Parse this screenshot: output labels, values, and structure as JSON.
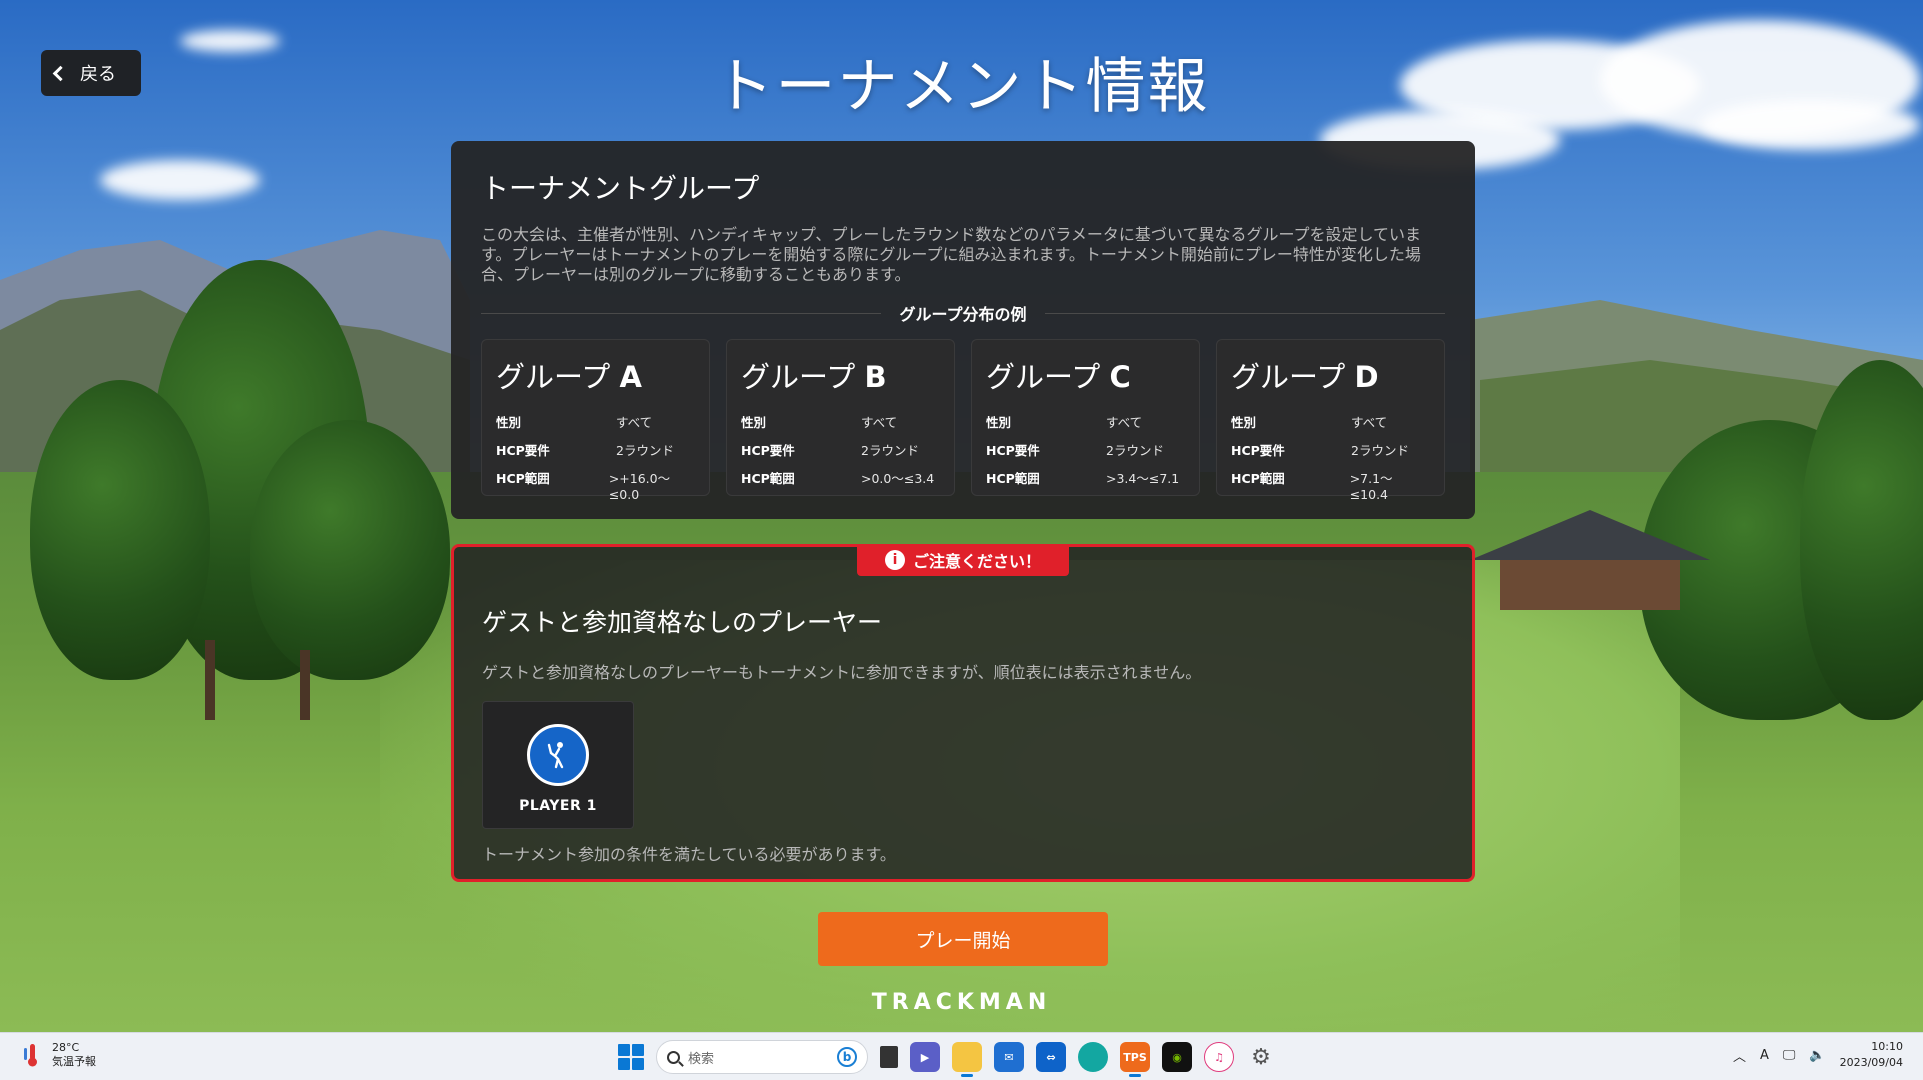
{
  "header": {
    "back_label": "戻る",
    "title": "トーナメント情報"
  },
  "groups_panel": {
    "title": "トーナメントグループ",
    "description": "この大会は、主催者が性別、ハンディキャップ、プレーしたラウンド数などのパラメータに基づいて異なるグループを設定しています。プレーヤーはトーナメントのプレーを開始する際にグループに組み込まれます。トーナメント開始前にプレー特性が変化した場合、プレーヤーは別のグループに移動することもあります。",
    "example_label": "グループ分布の例",
    "groups": [
      {
        "prefix": "グループ ",
        "letter": "A",
        "rows": [
          {
            "k": "性別",
            "v": "すべて"
          },
          {
            "k": "HCP要件",
            "v": "2ラウンド"
          },
          {
            "k": "HCP範囲",
            "v": ">+16.0〜≤0.0"
          }
        ]
      },
      {
        "prefix": "グループ ",
        "letter": "B",
        "rows": [
          {
            "k": "性別",
            "v": "すべて"
          },
          {
            "k": "HCP要件",
            "v": "2ラウンド"
          },
          {
            "k": "HCP範囲",
            "v": ">0.0〜≤3.4"
          }
        ]
      },
      {
        "prefix": "グループ ",
        "letter": "C",
        "rows": [
          {
            "k": "性別",
            "v": "すべて"
          },
          {
            "k": "HCP要件",
            "v": "2ラウンド"
          },
          {
            "k": "HCP範囲",
            "v": ">3.4〜≤7.1"
          }
        ]
      },
      {
        "prefix": "グループ ",
        "letter": "D",
        "rows": [
          {
            "k": "性別",
            "v": "すべて"
          },
          {
            "k": "HCP要件",
            "v": "2ラウンド"
          },
          {
            "k": "HCP範囲",
            "v": ">7.1〜≤10.4"
          }
        ]
      }
    ]
  },
  "guest_panel": {
    "badge": "ご注意ください！",
    "badge_icon": "info-icon",
    "title": "ゲストと参加資格なしのプレーヤー",
    "description": "ゲストと参加資格なしのプレーヤーもトーナメントに参加できますが、順位表には表示されません。",
    "player": {
      "name": "PLAYER 1",
      "avatar_icon": "golfer-icon",
      "avatar_color": "#1565c8"
    },
    "footer": "トーナメント参加の条件を満たしている必要があります。"
  },
  "actions": {
    "play_label": "プレー開始",
    "play_color": "#ee6a1c"
  },
  "brand": "TRACKMAN",
  "colors": {
    "warning": "#e0202a",
    "panel": "#242425"
  },
  "taskbar": {
    "weather_temp": "28°C",
    "weather_label": "気温予報",
    "search_placeholder": "検索",
    "apps": [
      "file-icon",
      "teams-icon",
      "folder-icon",
      "mail-icon",
      "teamviewer-icon",
      "edge-icon",
      "tps-icon",
      "nvidia-icon",
      "itunes-icon",
      "settings-icon"
    ],
    "tps_label": "TPS",
    "ime": "A",
    "time": "10:10",
    "date": "2023/09/04"
  }
}
